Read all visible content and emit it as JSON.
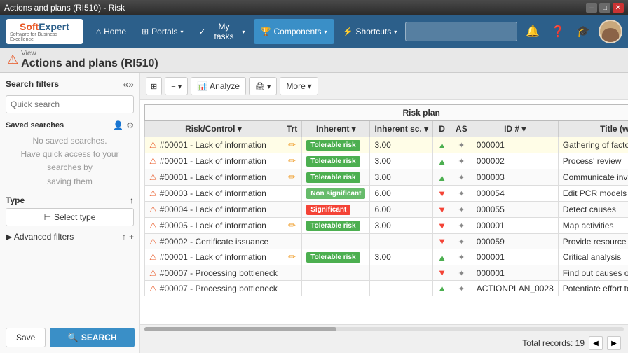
{
  "titleBar": {
    "title": "Actions and plans (RI510) - Risk",
    "minimize": "–",
    "maximize": "□",
    "close": "✕"
  },
  "navbar": {
    "logo": {
      "soft": "Soft",
      "expert": "Expert",
      "tagline": "Software for Business Excellence"
    },
    "home": "Home",
    "portals": "Portals",
    "myTasks": "My tasks",
    "components": "Components",
    "shortcuts": "Shortcuts",
    "searchPlaceholder": ""
  },
  "secondaryBar": {
    "viewLabel": "View",
    "pageTitle": "Actions and plans (RI510)"
  },
  "sidebar": {
    "title": "Search filters",
    "searchPlaceholder": "Quick search",
    "savedSearches": "Saved searches",
    "noSavedLine1": "No saved searches.",
    "noSavedLine2": "Have quick access to your searches by",
    "noSavedLine3": "saving them",
    "typeLabel": "Type",
    "selectTypeBtn": "Select type",
    "advancedFilters": "Advanced filters",
    "saveBtn": "Save",
    "searchBtn": "SEARCH"
  },
  "toolbar": {
    "analyzeBtn": "Analyze",
    "moreBtn": "More"
  },
  "table": {
    "sectionHeader": "Risk plan",
    "columns": [
      "Risk/Control",
      "Trt",
      "Inherent",
      "Inherent sc.",
      "D",
      "AS",
      "ID #",
      "Title (what?)"
    ],
    "rows": [
      {
        "riskControl": "#00001 - Lack of information",
        "trt": "edit",
        "inherent": "Tolerable risk",
        "inherentType": "tolerable",
        "inherentSc": "3.00",
        "d": "up",
        "as": "cross",
        "id": "000001",
        "title": "Gathering of factors",
        "highlight": true
      },
      {
        "riskControl": "#00001 - Lack of information",
        "trt": "edit",
        "inherent": "Tolerable risk",
        "inherentType": "tolerable",
        "inherentSc": "3.00",
        "d": "up",
        "as": "cross",
        "id": "000002",
        "title": "Process' review",
        "highlight": false
      },
      {
        "riskControl": "#00001 - Lack of information",
        "trt": "edit",
        "inherent": "Tolerable risk",
        "inherentType": "tolerable",
        "inherentSc": "3.00",
        "d": "up",
        "as": "cross",
        "id": "000003",
        "title": "Communicate involved",
        "highlight": false
      },
      {
        "riskControl": "#00003 - Lack of information",
        "trt": "",
        "inherent": "Non significant",
        "inherentType": "non-significant",
        "inherentSc": "6.00",
        "d": "down",
        "as": "cross4",
        "id": "000054",
        "title": "Edit PCR models",
        "highlight": false
      },
      {
        "riskControl": "#00004 - Lack of information",
        "trt": "",
        "inherent": "Significant",
        "inherentType": "significant",
        "inherentSc": "6.00",
        "d": "down",
        "as": "cross4",
        "id": "000055",
        "title": "Detect causes",
        "highlight": false
      },
      {
        "riskControl": "#00005 - Lack of information",
        "trt": "edit",
        "inherent": "Tolerable risk",
        "inherentType": "tolerable",
        "inherentSc": "3.00",
        "d": "down",
        "as": "cross4",
        "id": "000001",
        "title": "Map activities",
        "highlight": false
      },
      {
        "riskControl": "#00002 - Certificate issuance",
        "trt": "",
        "inherent": "",
        "inherentType": "",
        "inherentSc": "",
        "d": "down",
        "as": "cross4",
        "id": "000059",
        "title": "Provide resource",
        "highlight": false
      },
      {
        "riskControl": "#00001 - Lack of information",
        "trt": "edit",
        "inherent": "Tolerable risk",
        "inherentType": "tolerable",
        "inherentSc": "3.00",
        "d": "up",
        "as": "cross4",
        "id": "000001",
        "title": "Critical analysis",
        "highlight": false
      },
      {
        "riskControl": "#00007 - Processing bottleneck",
        "trt": "",
        "inherent": "",
        "inherentType": "",
        "inherentSc": "",
        "d": "down",
        "as": "cross4",
        "id": "000001",
        "title": "Find out causes of problems",
        "highlight": false
      },
      {
        "riskControl": "#00007 - Processing bottleneck",
        "trt": "",
        "inherent": "",
        "inherentType": "",
        "inherentSc": "",
        "d": "up",
        "as": "cross4",
        "id": "ACTIONPLAN_0028",
        "title": "Potentiate effort to develop product",
        "highlight": false
      }
    ]
  },
  "footer": {
    "totalLabel": "Total records: 19",
    "prevDisabled": "◀",
    "next": "▶"
  }
}
